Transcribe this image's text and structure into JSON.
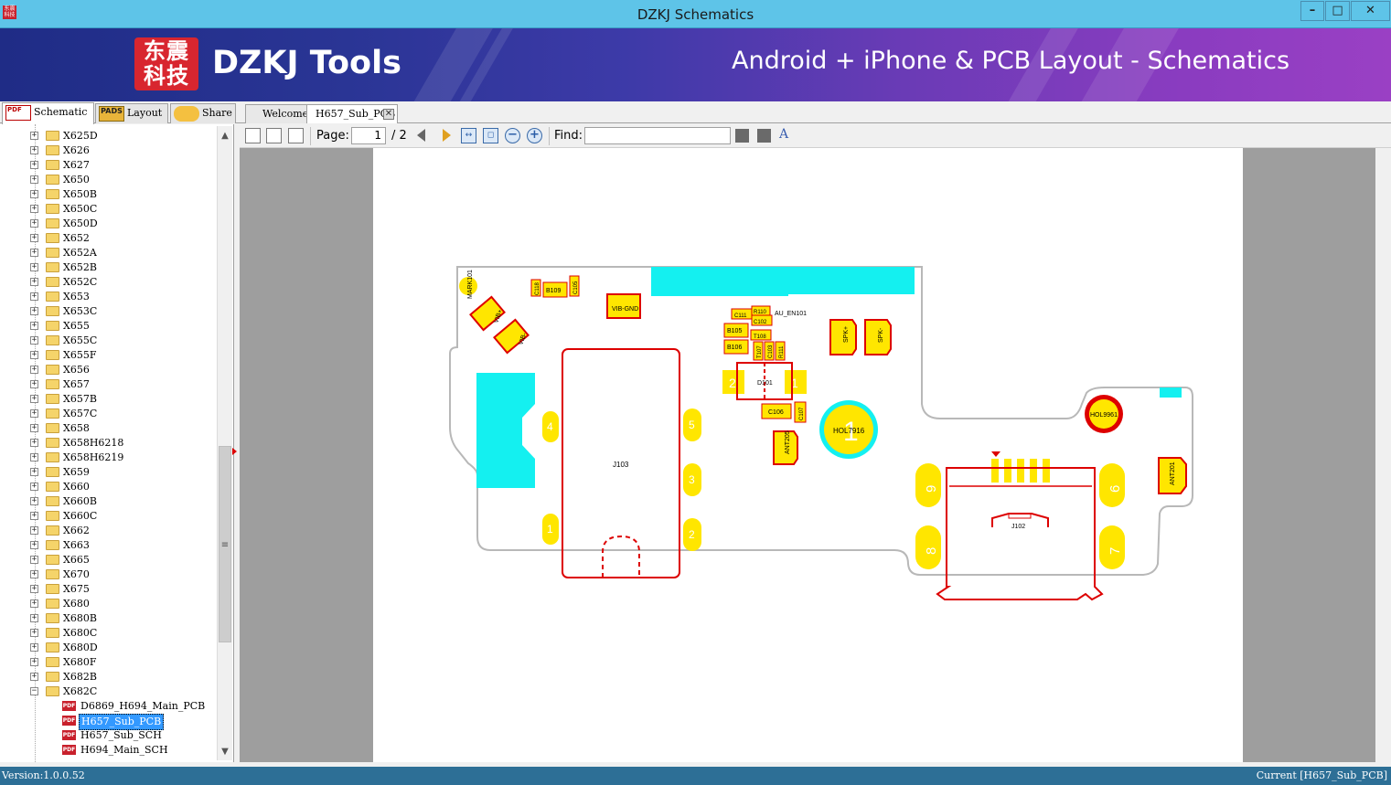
{
  "window": {
    "title": "DZKJ Schematics",
    "icon_text": "东震科技",
    "min_symbol": "–",
    "max_symbol": "□",
    "close_symbol": "✕"
  },
  "banner": {
    "logo_text": "东震科技",
    "brand": "DZKJ Tools",
    "tagline": "Android + iPhone & PCB Layout - Schematics"
  },
  "left_tabs": [
    {
      "label": "Schematic",
      "icon": "pdf-icon",
      "icon_text": "PDF",
      "active": true
    },
    {
      "label": "Layout",
      "icon": "pads-icon",
      "icon_text": "PADS",
      "active": false
    },
    {
      "label": "Share",
      "icon": "share-cloud-icon",
      "icon_text": "",
      "active": false
    }
  ],
  "doc_tabs": [
    {
      "label": "Welcome",
      "active": false
    },
    {
      "label": "H657_Sub_PCB",
      "active": true,
      "close": "✕"
    }
  ],
  "tree": {
    "folders": [
      "X625D",
      "X626",
      "X627",
      "X650",
      "X650B",
      "X650C",
      "X650D",
      "X652",
      "X652A",
      "X652B",
      "X652C",
      "X653",
      "X653C",
      "X655",
      "X655C",
      "X655F",
      "X656",
      "X657",
      "X657B",
      "X657C",
      "X658",
      "X658H6218",
      "X658H6219",
      "X659",
      "X660",
      "X660B",
      "X660C",
      "X662",
      "X663",
      "X665",
      "X670",
      "X675",
      "X680",
      "X680B",
      "X680C",
      "X680D",
      "X680F",
      "X682B",
      "X682C"
    ],
    "expanded_folder": "X682C",
    "files": [
      "D6869_H694_Main_PCB",
      "H657_Sub_PCB",
      "H657_Sub_SCH",
      "H694_Main_SCH"
    ],
    "selected_file": "H657_Sub_PCB",
    "expander_plus": "+",
    "expander_minus": "−",
    "file_icon_text": "PDF"
  },
  "toolbar": {
    "page_label": "Page:",
    "page_value": "1",
    "page_total": "/ 2",
    "find_label": "Find:",
    "find_value": "",
    "zoom_out_symbol": "−",
    "zoom_in_symbol": "+"
  },
  "pcb": {
    "labels": {
      "mark101": "MARK101",
      "c118": "C118",
      "b109": "B109",
      "c105": "C105",
      "vib_gnd": "VIB-GND",
      "vib_plus": "VIB+",
      "vib_minus": "VIB-",
      "c111": "C111",
      "r110": "R110",
      "c102": "C102",
      "au_en101": "AU_EN101",
      "b105": "B105",
      "t108": "T108",
      "b106": "B106",
      "t107": "T107",
      "c103": "C103",
      "r111": "R111",
      "spk_plus": "SPK+",
      "spk_minus": "SPK-",
      "d101": "D101",
      "d101_pin2": "2",
      "d101_pin1": "1",
      "c106": "C106",
      "c107": "C107",
      "hol7916": "HOL7916",
      "hol7916_pin": "1",
      "ant205": "ANT205",
      "hol9961": "HOL9961",
      "ant201": "ANT201",
      "j103": "J103",
      "j102": "J102",
      "j103_pins": [
        "4",
        "1",
        "5",
        "3",
        "2"
      ],
      "j102_pins": [
        "9",
        "8",
        "6",
        "7"
      ]
    }
  },
  "status": {
    "version": "Version:1.0.0.52",
    "current": "Current [H657_Sub_PCB]"
  }
}
